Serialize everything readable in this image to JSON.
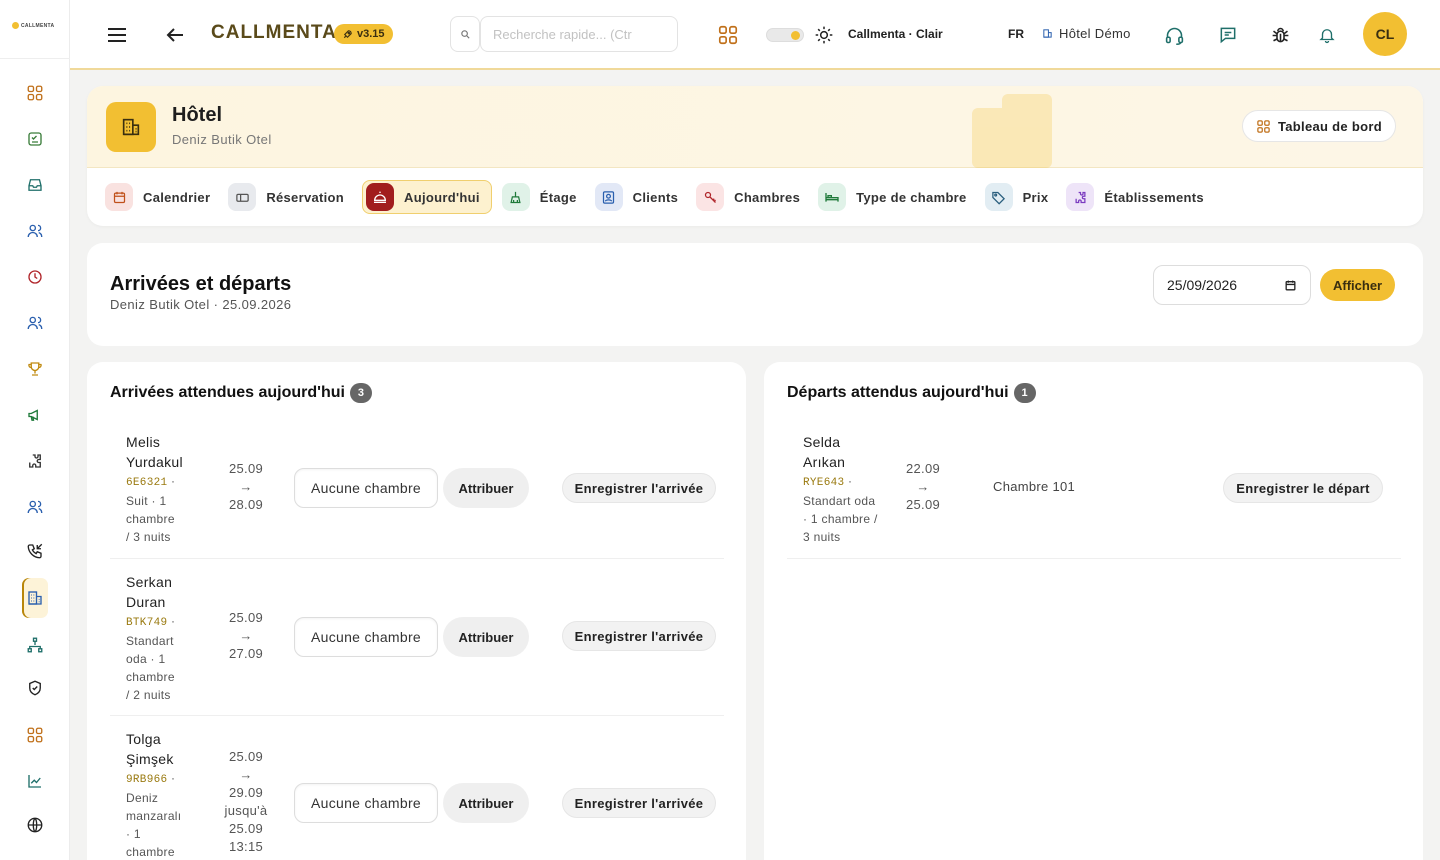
{
  "brand": {
    "logo_text": "CALLMENTA",
    "name": "CALLMENTA",
    "version": "v3.15"
  },
  "topbar": {
    "search_placeholder": "Recherche rapide... (Ctr",
    "theme_label": "Callmenta · Clair",
    "language": "FR",
    "hotel": "Hôtel Démo",
    "avatar_initials": "CL"
  },
  "sidebar": {
    "icons": [
      "grid-icon",
      "checklist-icon",
      "inbox-icon",
      "users-icon",
      "clock-icon",
      "team-icon",
      "trophy-icon",
      "megaphone-icon",
      "puzzle-icon",
      "contacts-icon",
      "phone-call-icon",
      "hotel-icon",
      "hierarchy-icon",
      "shield-check-icon",
      "apps-icon",
      "chart-icon",
      "globe-icon"
    ],
    "active": "hotel-icon"
  },
  "header": {
    "title": "Hôtel",
    "subtitle": "Deniz Butik Otel",
    "dashboard_label": "Tableau de bord",
    "tabs": [
      {
        "label": "Calendrier",
        "icon": "calendar-icon",
        "color": "#f9e2e0"
      },
      {
        "label": "Réservation",
        "icon": "booking-icon",
        "color": "#e8eaee"
      },
      {
        "label": "Aujourd'hui",
        "icon": "service-bell-icon",
        "color": "#a11d1d",
        "active": true
      },
      {
        "label": "Étage",
        "icon": "broom-icon",
        "color": "#e0f2e8"
      },
      {
        "label": "Clients",
        "icon": "user-card-icon",
        "color": "#e2e8f6"
      },
      {
        "label": "Chambres",
        "icon": "key-icon",
        "color": "#fbe4e4"
      },
      {
        "label": "Type de chambre",
        "icon": "bed-icon",
        "color": "#e0f2e8"
      },
      {
        "label": "Prix",
        "icon": "tag-icon",
        "color": "#e2edf3"
      },
      {
        "label": "Établissements",
        "icon": "building-icon",
        "color": "#eee4f8"
      }
    ]
  },
  "date_section": {
    "title": "Arrivées et départs",
    "subtitle": "Deniz Butik Otel · 25.09.2026",
    "date_value": "25/09/2026",
    "show_label": "Afficher"
  },
  "arrivals": {
    "title": "Arrivées attendues aujourd'hui",
    "count": "3",
    "room_placeholder": "Aucune chambre",
    "assign_label": "Attribuer",
    "checkin_label": "Enregistrer l'arrivée",
    "items": [
      {
        "name1": "Melis",
        "name2": "Yurdakul",
        "code": "6E6321",
        "meta": [
          "Suit · 1",
          "chambre",
          "/ 3 nuits"
        ],
        "dates": [
          "25.09",
          "→",
          "28.09"
        ]
      },
      {
        "name1": "Serkan",
        "name2": "Duran",
        "code": "BTK749",
        "meta": [
          "Standart",
          "oda · 1",
          "chambre",
          "/ 2 nuits"
        ],
        "dates": [
          "25.09",
          "→",
          "27.09"
        ]
      },
      {
        "name1": "Tolga",
        "name2": "Şimşek",
        "code": "9RB966",
        "meta": [
          "Deniz",
          "manzaralı",
          "· 1",
          "chambre"
        ],
        "dates": [
          "25.09",
          "→",
          "29.09",
          "jusqu'à",
          "25.09",
          "13:15"
        ]
      }
    ]
  },
  "departures": {
    "title": "Départs attendus aujourd'hui",
    "count": "1",
    "checkout_label": "Enregistrer le départ",
    "items": [
      {
        "name1": "Selda",
        "name2": "Arıkan",
        "code": "RYE643",
        "meta": [
          "Standart oda",
          "· 1 chambre /",
          "3 nuits"
        ],
        "dates": [
          "22.09",
          "→",
          "25.09"
        ],
        "room": "Chambre 101"
      }
    ]
  }
}
